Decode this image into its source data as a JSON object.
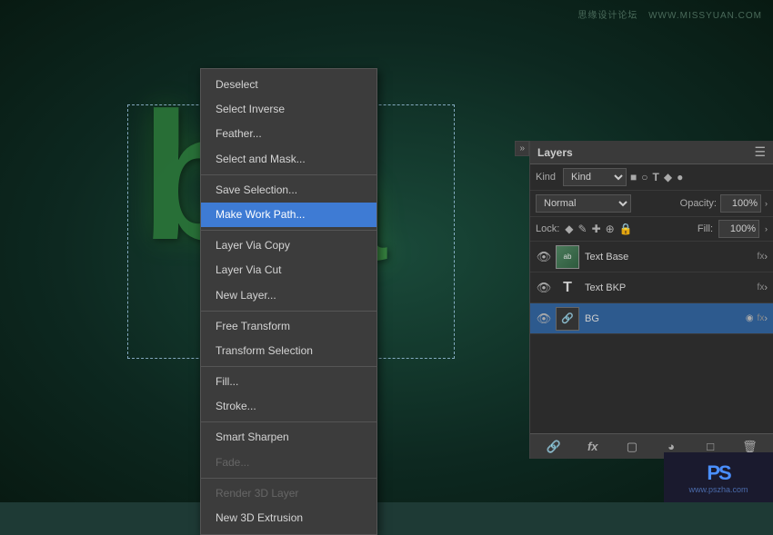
{
  "watermark": {
    "text1": "思缘设计论坛",
    "text2": "WWW.MISSYUAN.COM"
  },
  "canvas": {
    "text_b": "b",
    "text_a": "a"
  },
  "context_menu": {
    "items": [
      {
        "id": "deselect",
        "label": "Deselect",
        "disabled": false,
        "separator_after": false
      },
      {
        "id": "select-inverse",
        "label": "Select Inverse",
        "disabled": false,
        "separator_after": false
      },
      {
        "id": "feather",
        "label": "Feather...",
        "disabled": false,
        "separator_after": false
      },
      {
        "id": "select-mask",
        "label": "Select and Mask...",
        "disabled": false,
        "separator_after": true
      },
      {
        "id": "save-selection",
        "label": "Save Selection...",
        "disabled": false,
        "separator_after": false
      },
      {
        "id": "make-work-path",
        "label": "Make Work Path...",
        "disabled": false,
        "active": true,
        "separator_after": true
      },
      {
        "id": "layer-via-copy",
        "label": "Layer Via Copy",
        "disabled": false,
        "separator_after": false
      },
      {
        "id": "layer-via-cut",
        "label": "Layer Via Cut",
        "disabled": false,
        "separator_after": false
      },
      {
        "id": "new-layer",
        "label": "New Layer...",
        "disabled": false,
        "separator_after": true
      },
      {
        "id": "free-transform",
        "label": "Free Transform",
        "disabled": false,
        "separator_after": false
      },
      {
        "id": "transform-selection",
        "label": "Transform Selection",
        "disabled": false,
        "separator_after": true
      },
      {
        "id": "fill",
        "label": "Fill...",
        "disabled": false,
        "separator_after": false
      },
      {
        "id": "stroke",
        "label": "Stroke...",
        "disabled": false,
        "separator_after": true
      },
      {
        "id": "smart-sharpen",
        "label": "Smart Sharpen",
        "disabled": false,
        "separator_after": false
      },
      {
        "id": "fade",
        "label": "Fade...",
        "disabled": true,
        "separator_after": true
      },
      {
        "id": "render-3d",
        "label": "Render 3D Layer",
        "disabled": true,
        "separator_after": false
      },
      {
        "id": "new-3d",
        "label": "New 3D Extrusion",
        "disabled": false,
        "separator_after": false
      }
    ]
  },
  "layers_panel": {
    "title": "Layers",
    "kind_label": "Kind",
    "blend_mode": "Normal",
    "opacity_label": "Opacity:",
    "opacity_value": "100%",
    "lock_label": "Lock:",
    "fill_label": "Fill:",
    "fill_value": "100%",
    "layers": [
      {
        "id": "text-base",
        "name": "Text Base",
        "type": "image",
        "visible": true,
        "has_fx": true,
        "active": false
      },
      {
        "id": "text-bkp",
        "name": "Text BKP",
        "type": "text",
        "visible": true,
        "has_fx": true,
        "active": false
      },
      {
        "id": "bg",
        "name": "BG",
        "type": "smart",
        "visible": true,
        "has_fx": true,
        "active": true
      }
    ],
    "bottom_buttons": [
      "link",
      "fx",
      "new-fill",
      "new-layer",
      "delete"
    ]
  },
  "site_url": "www.pszha.com"
}
